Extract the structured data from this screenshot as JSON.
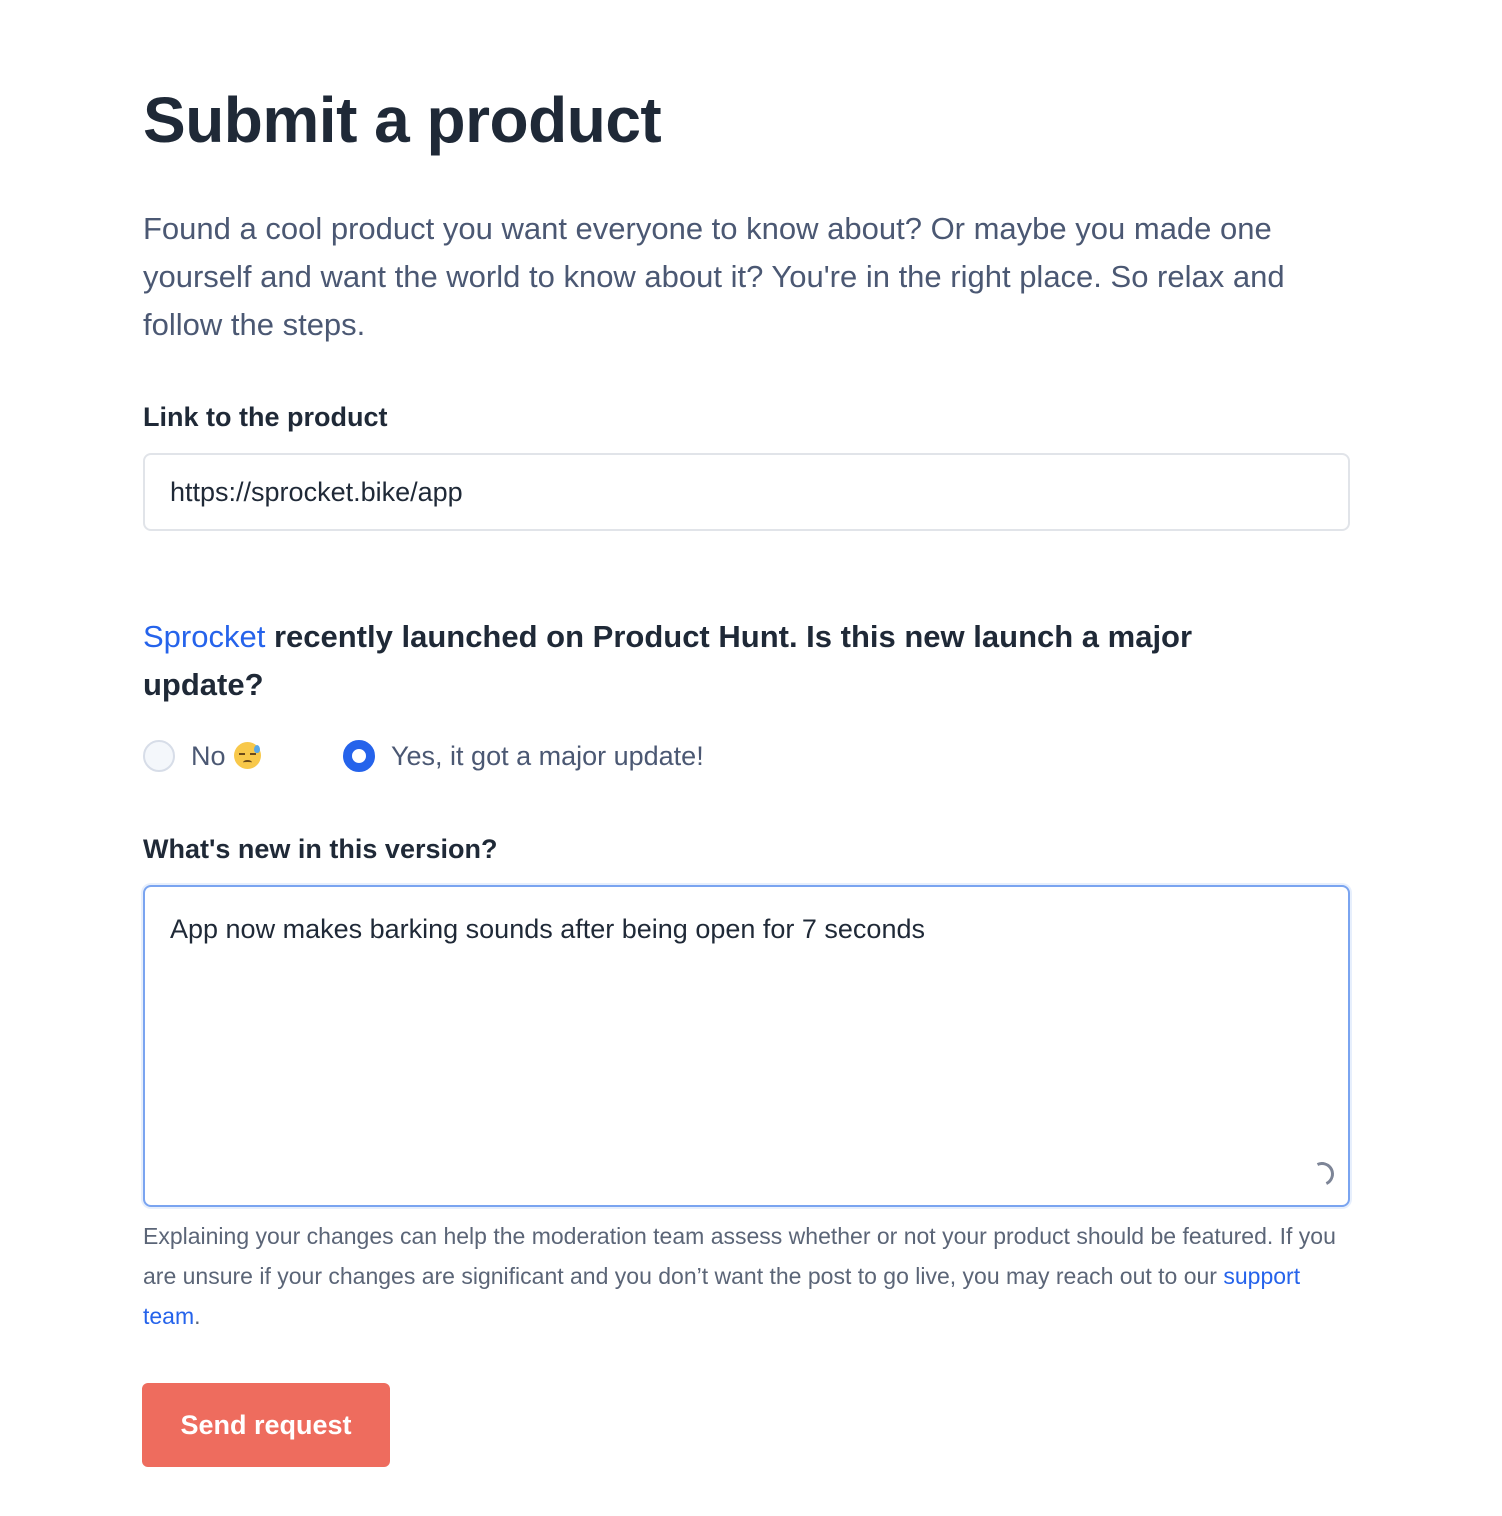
{
  "page": {
    "title": "Submit a product",
    "intro": "Found a cool product you want everyone to know about? Or maybe you made one yourself and want the world to know about it? You're in the right place. So relax and follow the steps."
  },
  "link_field": {
    "label": "Link to the product",
    "value": "https://sprocket.bike/app"
  },
  "launch_question": {
    "product_name": "Sprocket",
    "text": " recently launched on Product Hunt. Is this new launch a major update?"
  },
  "update_options": [
    {
      "label": "No",
      "icon": "downcast-sweat-face-icon",
      "selected": false
    },
    {
      "label": "Yes, it got a major update!",
      "selected": true
    }
  ],
  "version_field": {
    "label": "What's new in this version?",
    "value": "App now makes barking sounds after being open for 7 seconds",
    "status_icon": "loading-spinner-icon"
  },
  "help": {
    "text": "Explaining your changes can help the moderation team assess whether or not your product should be featured. If you are unsure if your changes are significant and you don’t want the post to go live, you may reach out to our ",
    "link_label": "support team",
    "suffix": "."
  },
  "submit": {
    "label": "Send request"
  },
  "colors": {
    "accent": "#2563eb",
    "button": "#ee6c5e",
    "heading": "#1f2937",
    "body_text": "#4b5873"
  }
}
